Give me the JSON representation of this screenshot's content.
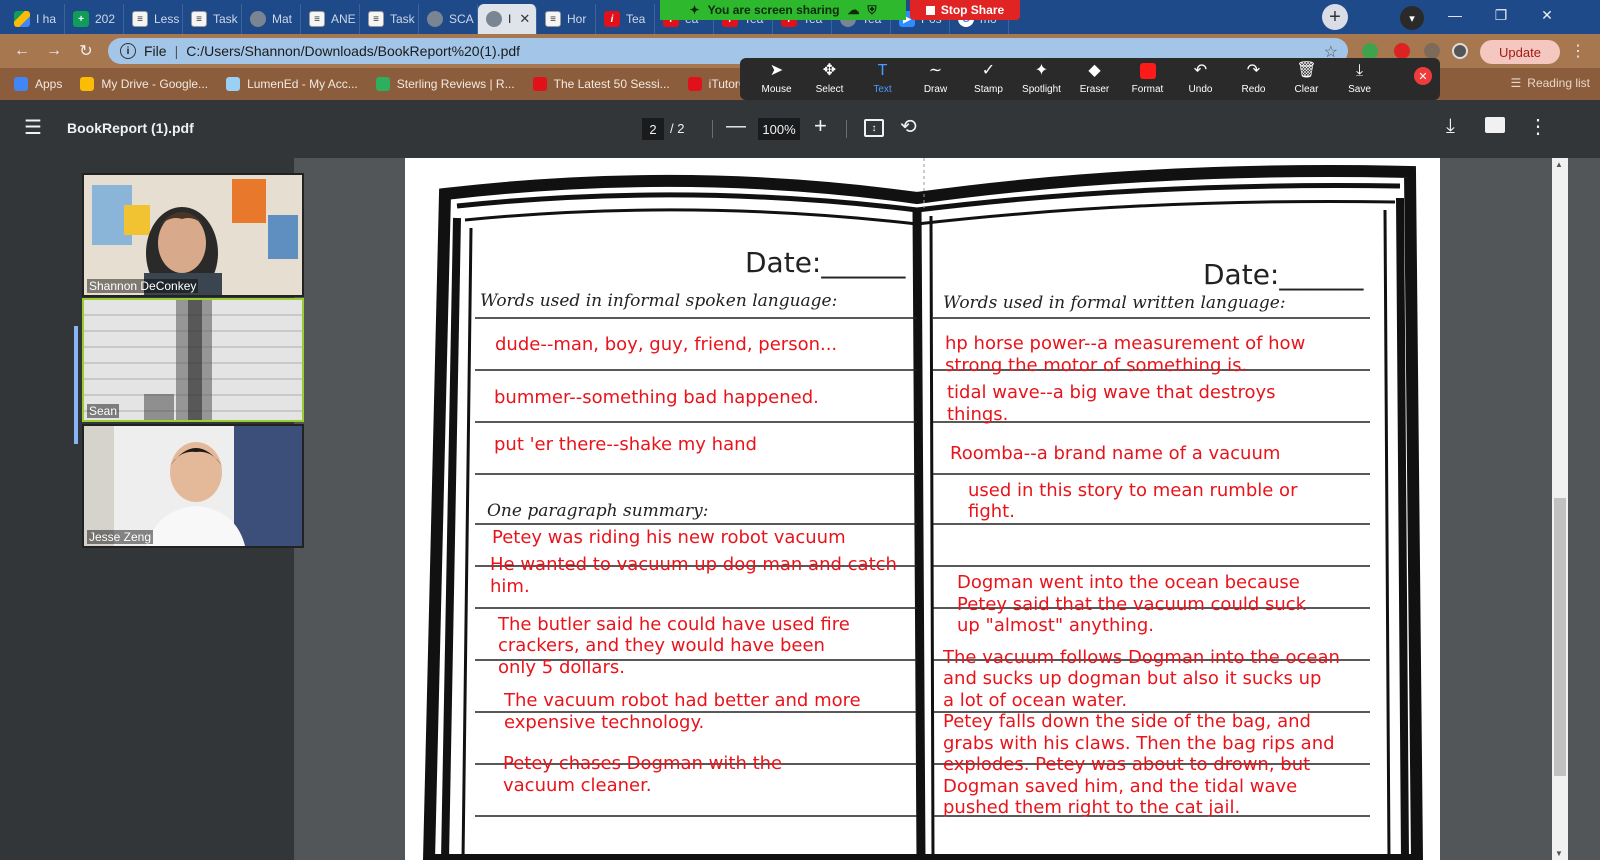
{
  "browser": {
    "tabs": [
      {
        "label": "I ha",
        "favicon": "drive"
      },
      {
        "label": "202",
        "favicon": "sheets"
      },
      {
        "label": "Less",
        "favicon": "doc"
      },
      {
        "label": "Task",
        "favicon": "doc"
      },
      {
        "label": "Mat",
        "favicon": "globe"
      },
      {
        "label": "ANE",
        "favicon": "doc"
      },
      {
        "label": "Task",
        "favicon": "doc"
      },
      {
        "label": "SCA",
        "favicon": "globe"
      },
      {
        "label": "I",
        "favicon": "globe",
        "active": true
      },
      {
        "label": "Hor",
        "favicon": "doc"
      },
      {
        "label": "Tea",
        "favicon": "red"
      },
      {
        "label": "ea",
        "favicon": "red"
      },
      {
        "label": "Tea",
        "favicon": "red"
      },
      {
        "label": "Tea",
        "favicon": "red"
      },
      {
        "label": "Tea",
        "favicon": "globe"
      },
      {
        "label": "Pos",
        "favicon": "zoom"
      },
      {
        "label": "mo",
        "favicon": "g"
      }
    ],
    "share_banner": "You are screen sharing",
    "stop_share": "Stop Share",
    "address": {
      "scheme_label": "File",
      "url": "C:/Users/Shannon/Downloads/BookReport%20(1).pdf"
    },
    "update_label": "Update",
    "bookmarks": [
      {
        "label": "Apps",
        "icon": "apps-grid-icon"
      },
      {
        "label": "My Drive - Google...",
        "icon": "drive-icon"
      },
      {
        "label": "LumenEd - My Acc...",
        "icon": "lumened-icon"
      },
      {
        "label": "Sterling Reviews | R...",
        "icon": "star-icon"
      },
      {
        "label": "The Latest 50 Sessi...",
        "icon": "itutor-icon"
      },
      {
        "label": "iTutorGro",
        "icon": "itutor-icon"
      }
    ],
    "reading_list": "Reading list"
  },
  "annotate_toolbar": {
    "tools": [
      {
        "label": "Mouse",
        "glyph": "➤"
      },
      {
        "label": "Select",
        "glyph": "✥"
      },
      {
        "label": "Text",
        "glyph": "T",
        "active": true
      },
      {
        "label": "Draw",
        "glyph": "∼"
      },
      {
        "label": "Stamp",
        "glyph": "✓"
      },
      {
        "label": "Spotlight",
        "glyph": "✦"
      },
      {
        "label": "Eraser",
        "glyph": "◆"
      },
      {
        "label": "Format",
        "glyph": "■"
      },
      {
        "label": "Undo",
        "glyph": "↶"
      },
      {
        "label": "Redo",
        "glyph": "↷"
      },
      {
        "label": "Clear",
        "glyph": "🗑"
      },
      {
        "label": "Save",
        "glyph": "⤓"
      }
    ],
    "format_color": "#ff1a1a"
  },
  "pdf_toolbar": {
    "title": "BookReport (1).pdf",
    "page_current": "2",
    "page_total": "/  2",
    "zoom": "100%"
  },
  "participants": [
    {
      "name": "Shannon DeConkey"
    },
    {
      "name": "Sean"
    },
    {
      "name": "Jesse Zeng"
    }
  ],
  "worksheet": {
    "left_date": "Date:______",
    "right_date": "Date:______",
    "left_header": "Words used in informal spoken language:",
    "right_header": "Words used in formal written language:",
    "summary_header": "One paragraph summary:",
    "left_entries": [
      "dude--man, boy, guy, friend, person...",
      "bummer--something bad happened.",
      "put 'er there--shake my hand"
    ],
    "summary_lines": [
      "Petey was riding his new robot vacuum",
      "He wanted to vacuum up dog man and catch",
      "him.",
      "The butler said he could have used fire",
      "crackers, and they would have been",
      "only 5 dollars.",
      "The vacuum robot had better and more",
      "expensive technology.",
      "Petey chases Dogman with the",
      "vacuum cleaner."
    ],
    "right_entries": [
      "hp horse power--a measurement of how",
      "strong the motor of something is.",
      "tidal wave--a big wave that destroys",
      "things.",
      "Roomba--a brand name of a vacuum",
      "used in this story to mean rumble or",
      "fight."
    ],
    "right_summary_lines": [
      "Dogman went into the ocean because",
      "Petey said that the vacuum could suck",
      "up \"almost\" anything.",
      "The vacuum follows Dogman into the ocean",
      "and sucks up dogman but also it sucks up",
      "a lot of ocean water.",
      "Petey falls down the side of the bag, and",
      "grabs with his claws. Then the bag rips and",
      "explodes. Petey was about to drown, but",
      "Dogman saved him, and the tidal wave",
      "pushed them right to the cat jail."
    ],
    "annotation_color": "#e8141b"
  }
}
